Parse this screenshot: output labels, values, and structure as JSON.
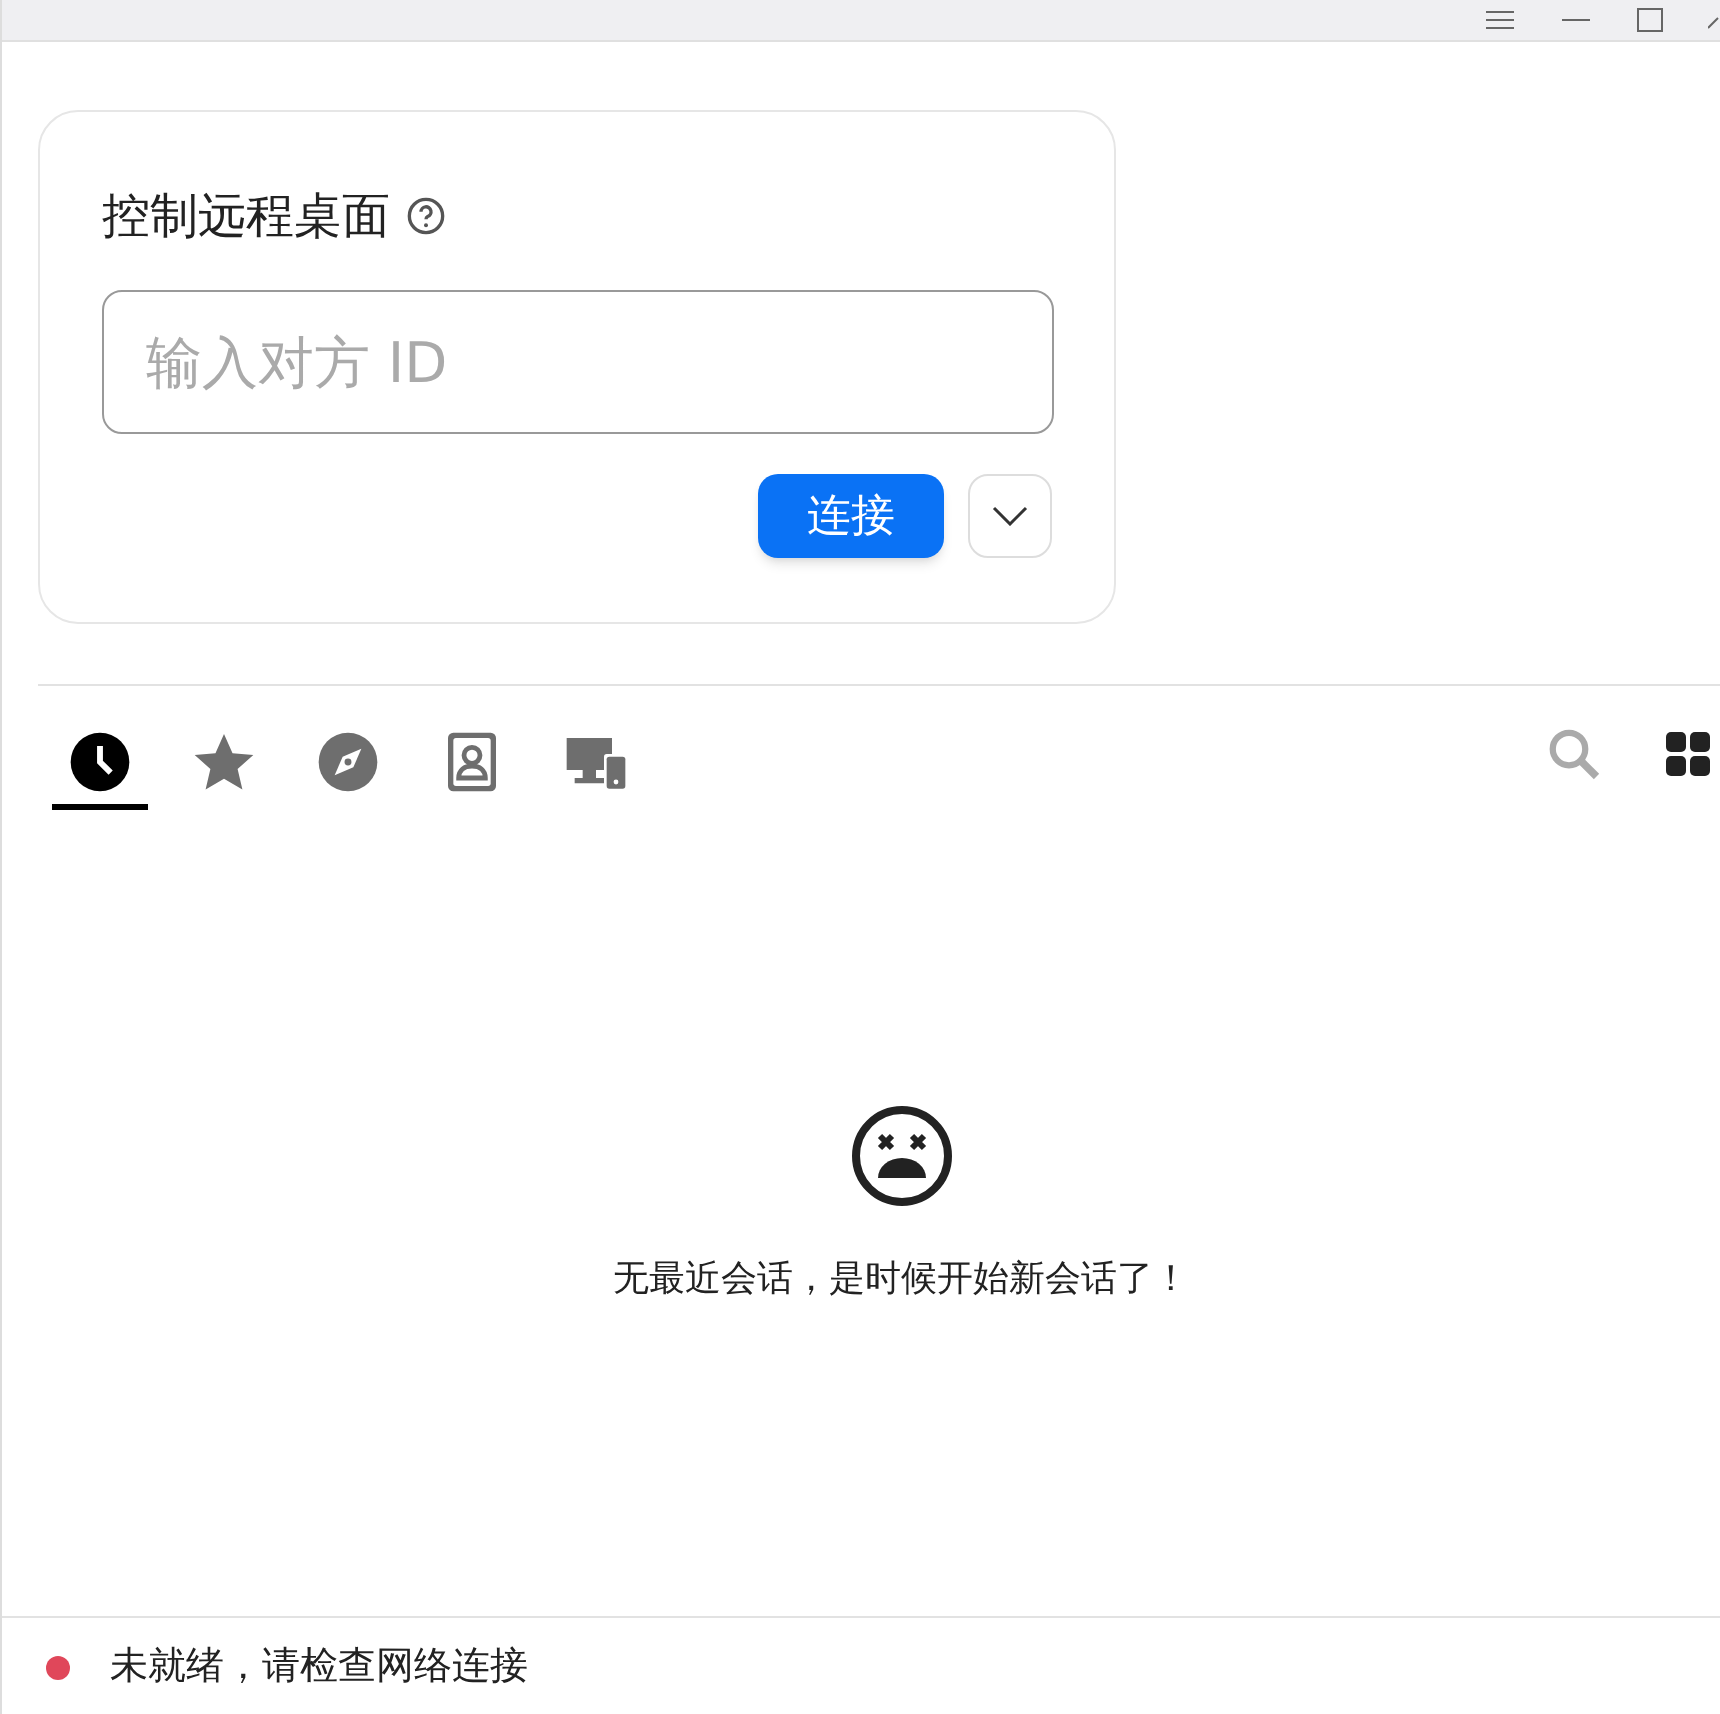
{
  "remote_control": {
    "title": "控制远程桌面",
    "id_field": {
      "placeholder": "输入对方 ID"
    },
    "connect_button": "连接"
  },
  "tabs": [
    {
      "kind": "recent",
      "selected": true
    },
    {
      "kind": "favorites",
      "selected": false
    },
    {
      "kind": "discovered",
      "selected": false
    },
    {
      "kind": "address_book",
      "selected": false
    },
    {
      "kind": "devices",
      "selected": false
    }
  ],
  "empty_state": {
    "message": "无最近会话，是时候开始新会话了！"
  },
  "status_bar": {
    "text": "未就绪，请检查网络连接",
    "color": "#e0475a"
  }
}
